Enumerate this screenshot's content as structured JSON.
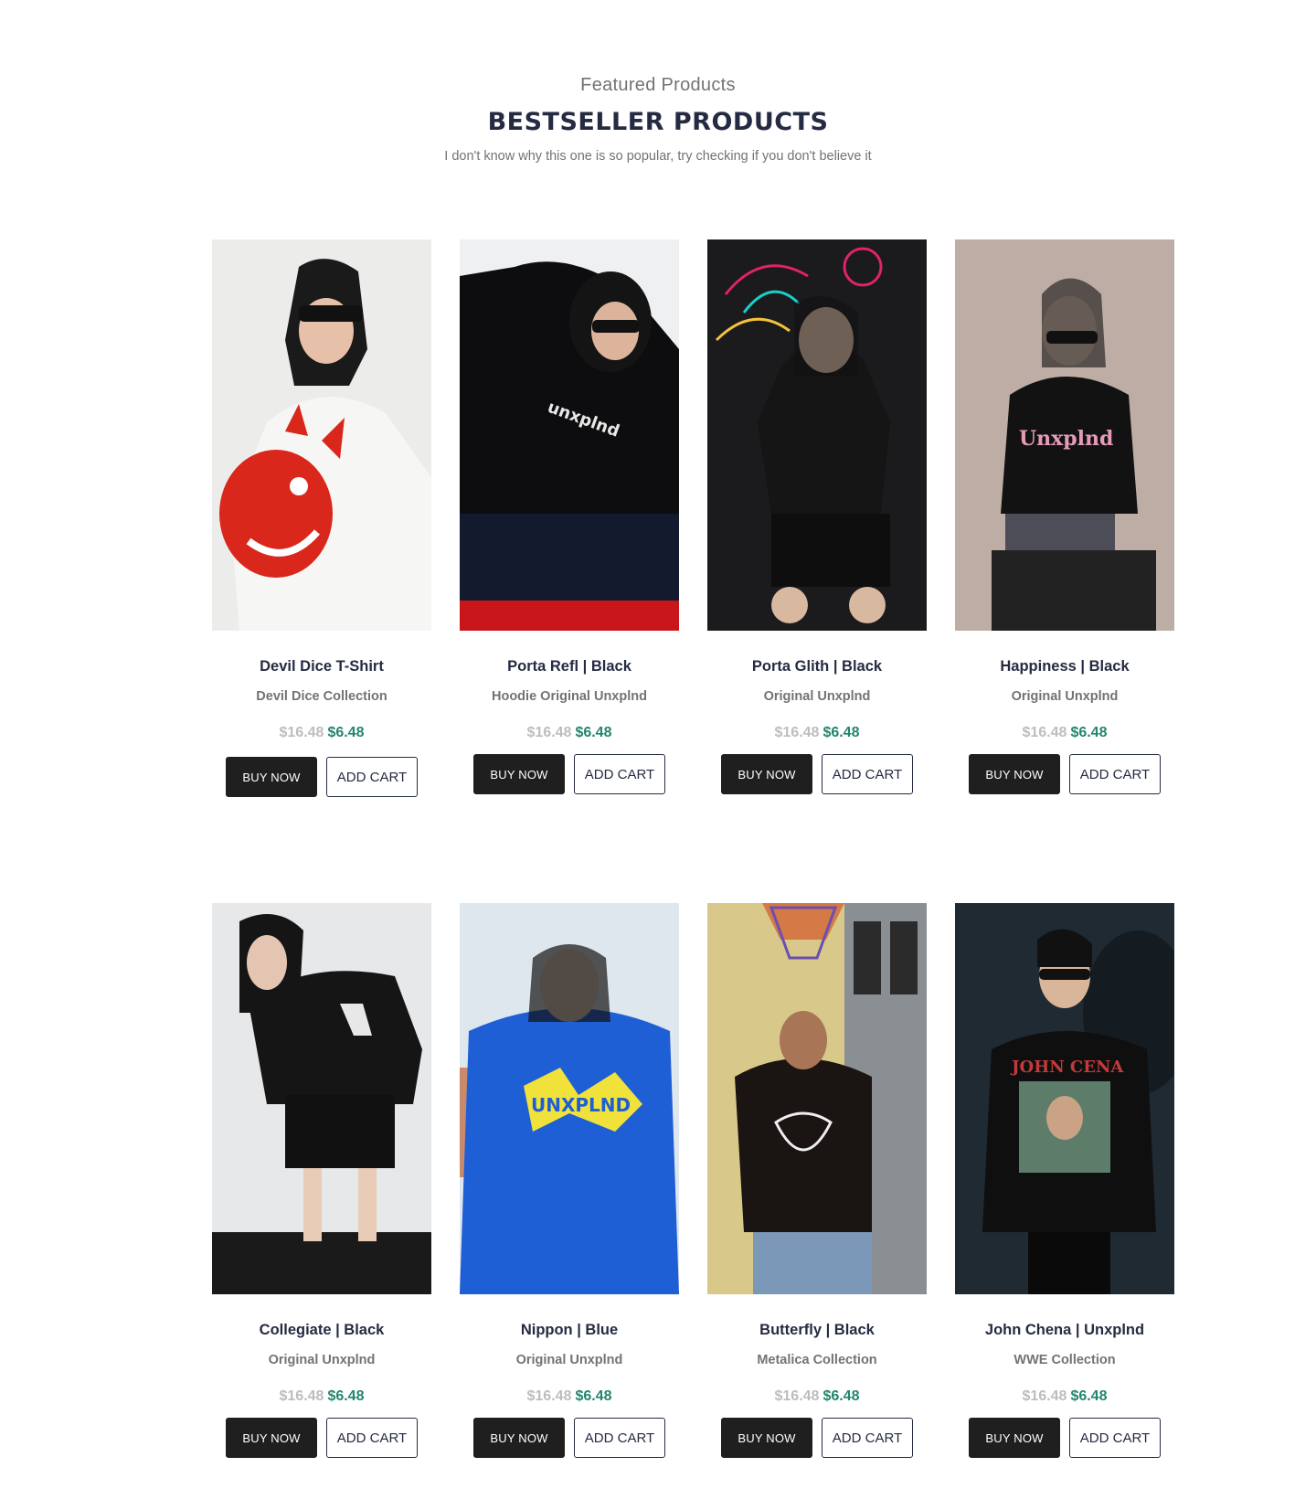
{
  "header": {
    "eyebrow": "Featured Products",
    "title": "BESTSELLER PRODUCTS",
    "subtitle": "I don't know why this one is so popular, try checking if you don't believe it"
  },
  "labels": {
    "buy": "BUY NOW",
    "add": "ADD CART"
  },
  "products": [
    {
      "name": "Devil Dice T-Shirt",
      "collection": "Devil Dice Collection",
      "old_price": "$16.48",
      "price": "$6.48"
    },
    {
      "name": "Porta Refl | Black",
      "collection": "Hoodie Original Unxplnd",
      "old_price": "$16.48",
      "price": "$6.48"
    },
    {
      "name": "Porta Glith | Black",
      "collection": "Original Unxplnd",
      "old_price": "$16.48",
      "price": "$6.48"
    },
    {
      "name": "Happiness | Black",
      "collection": "Original Unxplnd",
      "old_price": "$16.48",
      "price": "$6.48"
    },
    {
      "name": "Collegiate | Black",
      "collection": "Original Unxplnd",
      "old_price": "$16.48",
      "price": "$6.48"
    },
    {
      "name": "Nippon | Blue",
      "collection": "Original Unxplnd",
      "old_price": "$16.48",
      "price": "$6.48"
    },
    {
      "name": "Butterfly | Black",
      "collection": "Metalica Collection",
      "old_price": "$16.48",
      "price": "$6.48"
    },
    {
      "name": "John Chena | Unxplnd",
      "collection": "WWE Collection",
      "old_price": "$16.48",
      "price": "$6.48"
    }
  ],
  "colors": {
    "heading": "#252b42",
    "muted": "#737373",
    "old_price": "#bdbdbd",
    "sale_price": "#23856d",
    "button_dark": "#1f1f1f"
  }
}
